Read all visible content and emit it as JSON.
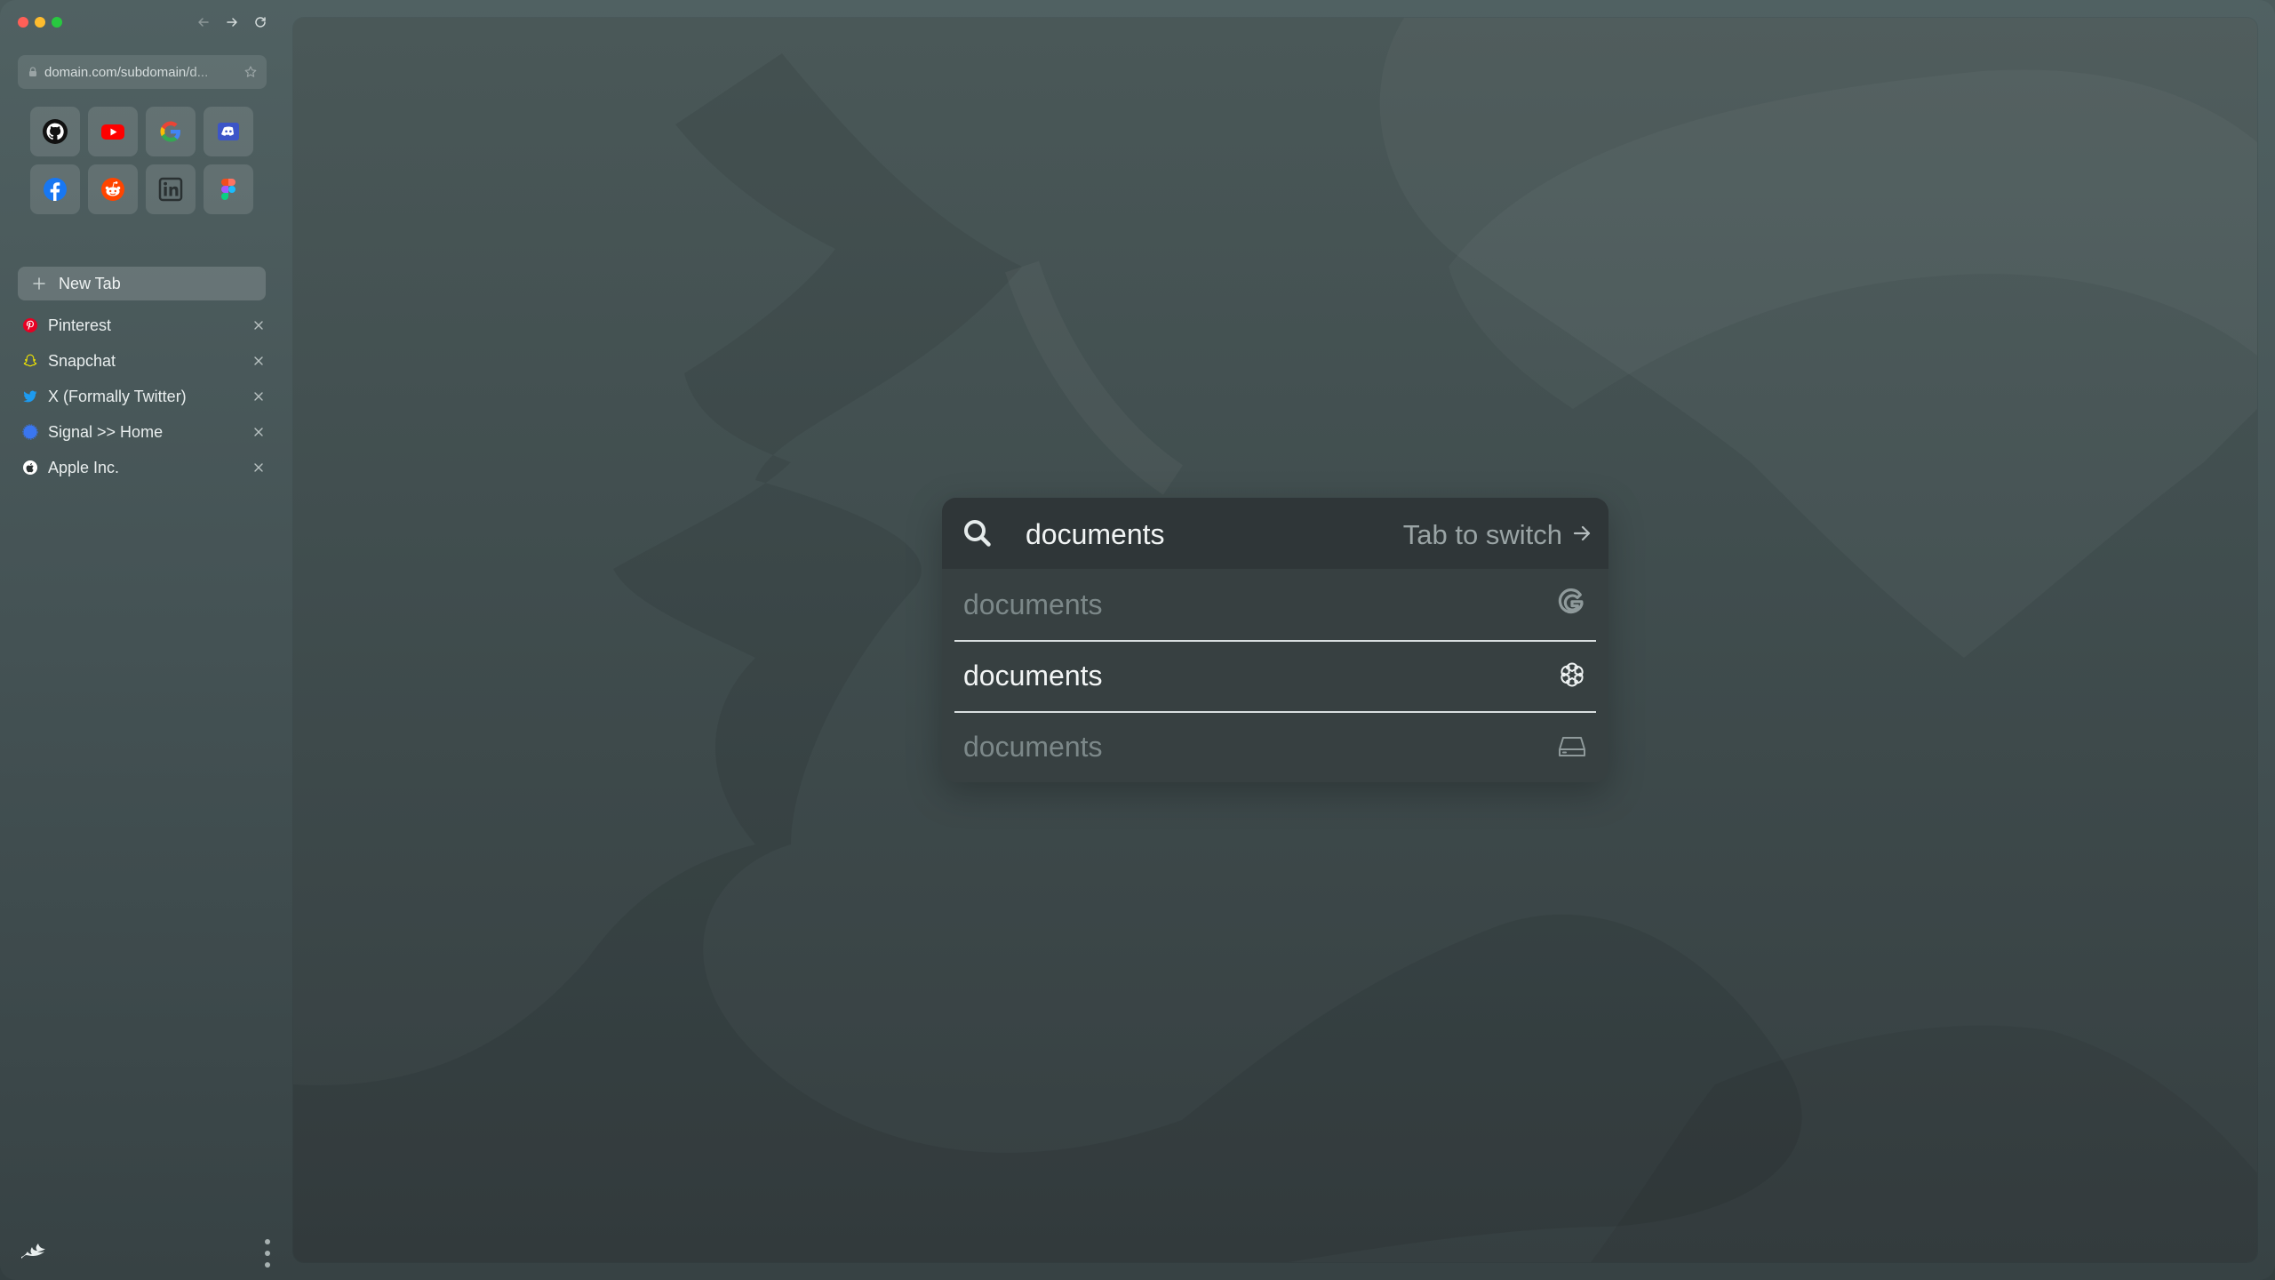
{
  "window": {
    "traffic_lights": [
      "close",
      "minimize",
      "zoom"
    ]
  },
  "nav": {
    "back_icon": "arrow-left-icon",
    "forward_icon": "arrow-right-icon",
    "reload_icon": "reload-icon"
  },
  "address_bar": {
    "url": "domain.com/subdomain/d..."
  },
  "favorites": [
    {
      "name": "GitHub",
      "icon": "github-icon"
    },
    {
      "name": "YouTube",
      "icon": "youtube-icon"
    },
    {
      "name": "Google",
      "icon": "google-icon"
    },
    {
      "name": "Discord",
      "icon": "discord-icon"
    },
    {
      "name": "Facebook",
      "icon": "facebook-icon"
    },
    {
      "name": "Reddit",
      "icon": "reddit-icon"
    },
    {
      "name": "LinkedIn",
      "icon": "linkedin-icon"
    },
    {
      "name": "Figma",
      "icon": "figma-icon"
    }
  ],
  "new_tab": {
    "label": "New Tab"
  },
  "tabs": [
    {
      "label": "Pinterest",
      "icon": "pinterest-icon",
      "color": "#e60023"
    },
    {
      "label": "Snapchat",
      "icon": "snapchat-icon",
      "color": "#fffc00"
    },
    {
      "label": "X (Formally Twitter)",
      "icon": "twitter-icon",
      "color": "#1d9bf0"
    },
    {
      "label": "Signal >> Home",
      "icon": "signal-icon",
      "color": "#3a76f0"
    },
    {
      "label": "Apple Inc.",
      "icon": "apple-icon",
      "color": "#ffffff"
    }
  ],
  "palette": {
    "query": "documents",
    "hint": "Tab to switch",
    "suggestions": [
      {
        "text": "documents",
        "icon": "google-icon",
        "selected": false
      },
      {
        "text": "documents",
        "icon": "openai-icon",
        "selected": true
      },
      {
        "text": "documents",
        "icon": "drive-icon",
        "selected": false
      }
    ]
  },
  "colors": {
    "accent": "#e6ecec",
    "palette_bg": "#373f41",
    "search_bg": "#2f3638"
  }
}
